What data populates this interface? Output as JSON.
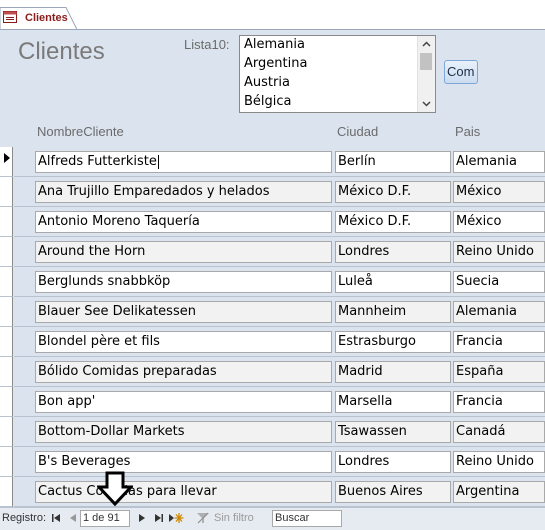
{
  "tab": {
    "label": "Clientes",
    "icon": "form-icon"
  },
  "form": {
    "title": "Clientes"
  },
  "filter": {
    "label": "Lista10:",
    "options": [
      "Alemania",
      "Argentina",
      "Austria",
      "Bélgica"
    ]
  },
  "com_button": {
    "label": "Com"
  },
  "columns": {
    "name": "NombreCliente",
    "city": "Ciudad",
    "country": "Pais"
  },
  "rows": [
    {
      "name": "Alfreds Futterkiste",
      "city": "Berlín",
      "country": "Alemania"
    },
    {
      "name": "Ana Trujillo Emparedados y helados",
      "city": "México D.F.",
      "country": "México"
    },
    {
      "name": "Antonio Moreno Taquería",
      "city": "México D.F.",
      "country": "México"
    },
    {
      "name": "Around the Horn",
      "city": "Londres",
      "country": "Reino Unido"
    },
    {
      "name": "Berglunds snabbköp",
      "city": "Luleå",
      "country": "Suecia"
    },
    {
      "name": "Blauer See Delikatessen",
      "city": "Mannheim",
      "country": "Alemania"
    },
    {
      "name": "Blondel père et fils",
      "city": "Estrasburgo",
      "country": "Francia"
    },
    {
      "name": "Bólido Comidas preparadas",
      "city": "Madrid",
      "country": "España"
    },
    {
      "name": "Bon app'",
      "city": "Marsella",
      "country": "Francia"
    },
    {
      "name": "Bottom-Dollar Markets",
      "city": "Tsawassen",
      "country": "Canadá"
    },
    {
      "name": "B's Beverages",
      "city": "Londres",
      "country": "Reino Unido"
    },
    {
      "name": "Cactus Comidas para llevar",
      "city": "Buenos Aires",
      "country": "Argentina"
    }
  ],
  "navigation": {
    "label": "Registro:",
    "first": "⏮",
    "prev": "◀",
    "current": "1 de 91",
    "next": "▶",
    "last": "⏭",
    "new": "▶✱",
    "filter_label": "Sin filtro",
    "search_placeholder": "Buscar"
  },
  "colors": {
    "header_bg": "#dbe3ee",
    "title": "#7a7a7a",
    "tab_label": "#8b1c1c",
    "button_border": "#7ea6d6"
  }
}
